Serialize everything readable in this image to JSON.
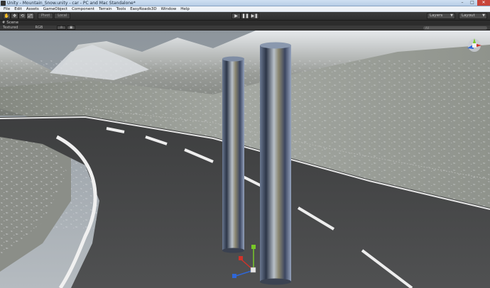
{
  "window": {
    "title": "Unity - Mountain_Snow.unity - car - PC and Mac Standalone*",
    "minimize": "–",
    "maximize": "□",
    "close": "✕"
  },
  "menu": [
    "File",
    "Edit",
    "Assets",
    "GameObject",
    "Component",
    "Terrain",
    "Tools",
    "EasyRoads3D",
    "Window",
    "Help"
  ],
  "toolbar": {
    "tools": [
      "✋",
      "✥",
      "⟲",
      "⤢"
    ],
    "pivot_label": "Pivot",
    "local_label": "Local",
    "play": "▶",
    "pause": "❚❚",
    "step": "▶❚",
    "layers_label": "Layers",
    "layout_label": "Layout"
  },
  "scene_tab": {
    "icon": "#",
    "label": "Scene",
    "render_mode": "Textured",
    "color_mode": "RGB",
    "search_placeholder": "All"
  },
  "colors": {
    "sky": "#9aa1a8",
    "road": "#4a4b4c",
    "snow": "#d9dde0",
    "accent_gizmo_x": "#d0332a",
    "accent_gizmo_y": "#78c828",
    "accent_gizmo_z": "#2f67d8"
  }
}
